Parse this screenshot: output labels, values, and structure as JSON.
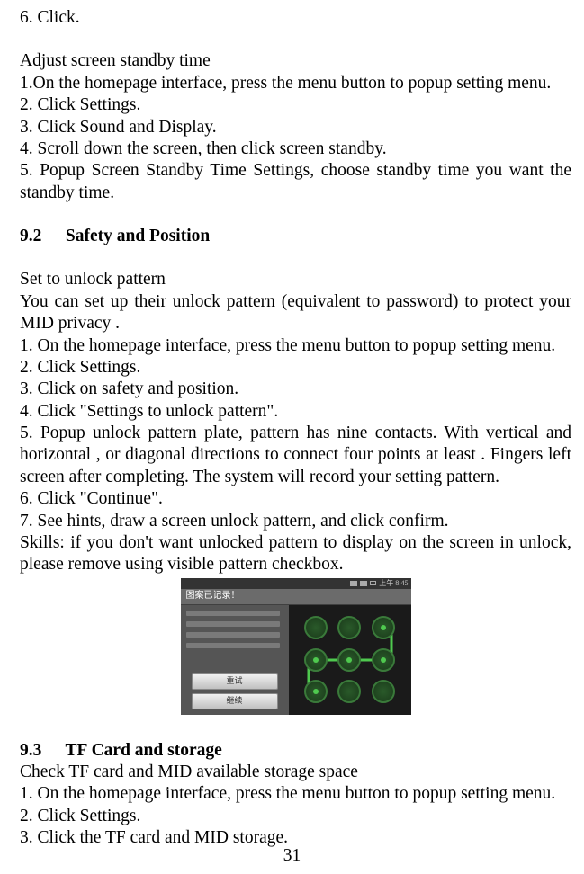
{
  "line_click": "6. Click.",
  "adjust_title": "Adjust screen standby time",
  "adjust_steps": {
    "s1": "1.On the homepage interface, press the menu button to popup setting menu.",
    "s2": "2. Click Settings.",
    "s3": "3. Click Sound and Display.",
    "s4": "4. Scroll down the screen, then click screen standby.",
    "s5": "5. Popup Screen Standby Time Settings, choose standby time you want the standby time."
  },
  "sec92_num": "9.2",
  "sec92_title": "Safety and Position",
  "unlock_title": "Set to unlock pattern",
  "unlock_intro": "You can set up their unlock pattern (equivalent to password) to protect your MID privacy .",
  "unlock_steps": {
    "s1": "1. On the homepage interface, press the menu button to popup setting menu.",
    "s2": "2. Click Settings.",
    "s3": "3. Click on safety and position.",
    "s4": "4. Click \"Settings to unlock pattern\".",
    "s5": "5. Popup unlock pattern plate, pattern has nine contacts. With vertical and horizontal , or diagonal directions to connect four points at least .   Fingers left screen after completing. The system will record your setting pattern.",
    "s6": "6. Click \"Continue\".",
    "s7": "7. See hints, draw a screen unlock pattern, and click confirm."
  },
  "unlock_skills": "Skills: if you don't want unlocked pattern to display on the screen in unlock, please remove using visible pattern checkbox.",
  "phone": {
    "status_time": "上午 8:45",
    "title_bar": "图案已记录！",
    "btn_retry": "重试",
    "btn_continue": "继续"
  },
  "sec93_num": "9.3",
  "sec93_title": "TF Card and storage",
  "tf_title": "Check TF card and MID available storage space",
  "tf_steps": {
    "s1": "1. On the homepage interface, press the menu button to popup setting menu.",
    "s2": "2. Click Settings.",
    "s3": "3. Click the TF card and MID storage."
  },
  "page_number": "31"
}
